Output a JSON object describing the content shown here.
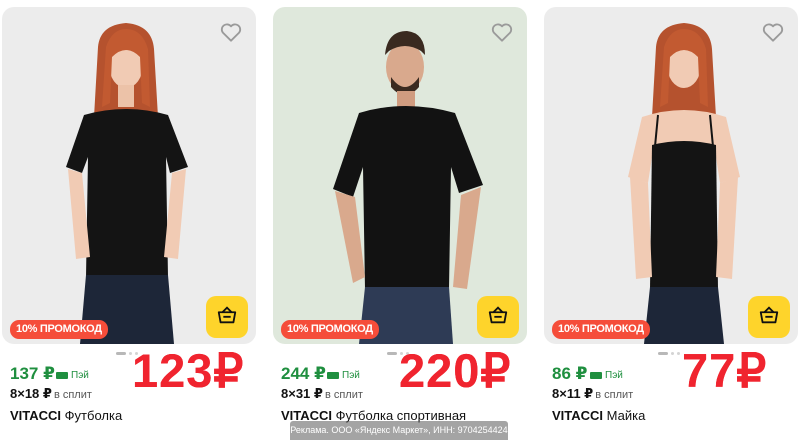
{
  "products": [
    {
      "promo": "10% ПРОМОКОД",
      "price": "137 ₽",
      "pay_label": "Пэй",
      "split_count": "8×18 ₽",
      "split_label": "в сплит",
      "brand": "VITACCI",
      "name": "Футболка",
      "big_price": "123₽"
    },
    {
      "promo": "10% ПРОМОКОД",
      "price": "244 ₽",
      "pay_label": "Пэй",
      "split_count": "8×31 ₽",
      "split_label": "в сплит",
      "brand": "VITACCI",
      "name": "Футболка спортивная",
      "big_price": "220₽"
    },
    {
      "promo": "10% ПРОМОКОД",
      "price": "86 ₽",
      "pay_label": "Пэй",
      "split_count": "8×11 ₽",
      "split_label": "в сплит",
      "brand": "VITACCI",
      "name": "Майка",
      "big_price": "77₽"
    }
  ],
  "ad_label": "Реклама. ООО «Яндекс Маркет», ИНН: 9704254424",
  "icons": {
    "favorite": "heart-icon",
    "cart": "basket-icon",
    "pay": "card-icon"
  },
  "colors": {
    "price_green": "#1f8f3f",
    "promo_red": "#f54d3a",
    "big_price_red": "#f0242f",
    "cart_yellow": "#fed42b"
  }
}
